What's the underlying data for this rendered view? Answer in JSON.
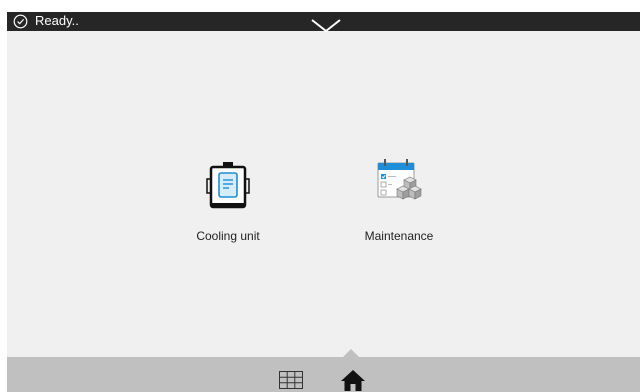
{
  "status": {
    "text": "Ready..",
    "icon": "check-circle-icon"
  },
  "header": {
    "collapse_icon": "chevron-down-icon"
  },
  "tiles": [
    {
      "label": "Cooling unit",
      "icon": "clipboard-icon"
    },
    {
      "label": "Maintenance",
      "icon": "calendar-checklist-cubes-icon"
    }
  ],
  "nav": {
    "grid_icon": "grid-icon",
    "home_icon": "home-icon",
    "active": "home"
  },
  "colors": {
    "status_bar": "#262626",
    "background": "#f0f0f0",
    "bottom_bar": "#c0c0c0",
    "accent_blue": "#1f8ed8"
  }
}
